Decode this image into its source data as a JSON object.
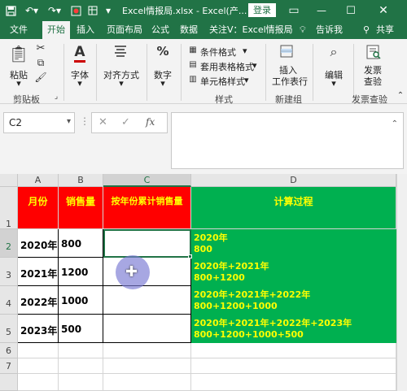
{
  "titlebar": {
    "title": "Excel情报局.xlsx  -  Excel(产...",
    "login_label": "登录"
  },
  "tabs": [
    "文件",
    "开始",
    "插入",
    "页面布局",
    "公式",
    "数据",
    "关注V：Excel情报局"
  ],
  "tell_me": "告诉我",
  "share": "共享",
  "ribbon": {
    "paste": "粘贴",
    "clipboard": "剪贴板",
    "font": "字体",
    "align": "对齐方式",
    "number": "数字",
    "cond_format": "条件格式",
    "table_format": "套用表格格式",
    "cell_style": "单元格样式",
    "styles": "样式",
    "insert_group": "插入",
    "work_line": "工作表行",
    "new_group": "新建组",
    "edit": "编辑",
    "invoice": "发票",
    "invoice2": "查验",
    "invoice_group": "发票查验"
  },
  "formula": {
    "namebox": "C2",
    "fx": "fx"
  },
  "columns": [
    "A",
    "B",
    "C",
    "D"
  ],
  "rows": [
    "1",
    "2",
    "3",
    "4",
    "5",
    "6",
    "7"
  ],
  "headers": {
    "a": "月份",
    "b": "销售量",
    "c": "按年份累计销售量",
    "d": "计算过程"
  },
  "data_rows": [
    {
      "a": "2020年",
      "b": "800",
      "d1": "2020年",
      "d2": "800"
    },
    {
      "a": "2021年",
      "b": "1200",
      "d1": "2020年+2021年",
      "d2": "800+1200"
    },
    {
      "a": "2022年",
      "b": "1000",
      "d1": "2020年+2021年+2022年",
      "d2": "800+1200+1000"
    },
    {
      "a": "2023年",
      "b": "500",
      "d1": "2020年+2021年+2022年+2023年",
      "d2": "800+1200+1000+500"
    }
  ],
  "colors": {
    "accent": "#217346",
    "red": "#ff0000",
    "green": "#00b050",
    "yellow": "#ffff00"
  }
}
